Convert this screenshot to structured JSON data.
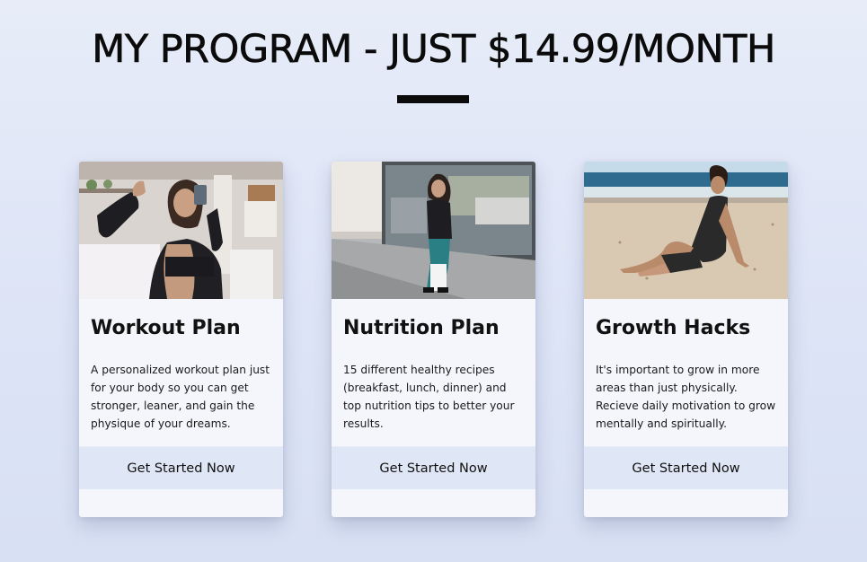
{
  "header": {
    "title": "MY PROGRAM - JUST $14.99/MONTH"
  },
  "cards": [
    {
      "image": "woman-taking-gym-mirror-selfie-photo",
      "title": "Workout Plan",
      "description": "A personalized workout plan just for your body so you can get stronger, leaner, and gain the physique of your dreams.",
      "cta": "Get Started Now"
    },
    {
      "image": "woman-walking-on-sidewalk-photo",
      "title": "Nutrition Plan",
      "description": "15 different healthy recipes (breakfast, lunch, dinner) and top nutrition tips to better your results.",
      "cta": "Get Started Now"
    },
    {
      "image": "woman-sitting-on-beach-photo",
      "title": "Growth Hacks",
      "description": "It's important to grow in more areas than just physically. Recieve daily motivation to grow mentally and spiritually.",
      "cta": "Get Started Now"
    }
  ],
  "colors": {
    "background": "#dde4f6",
    "card": "#f4f6fc",
    "button": "#dfe6f5",
    "text": "#111111"
  }
}
